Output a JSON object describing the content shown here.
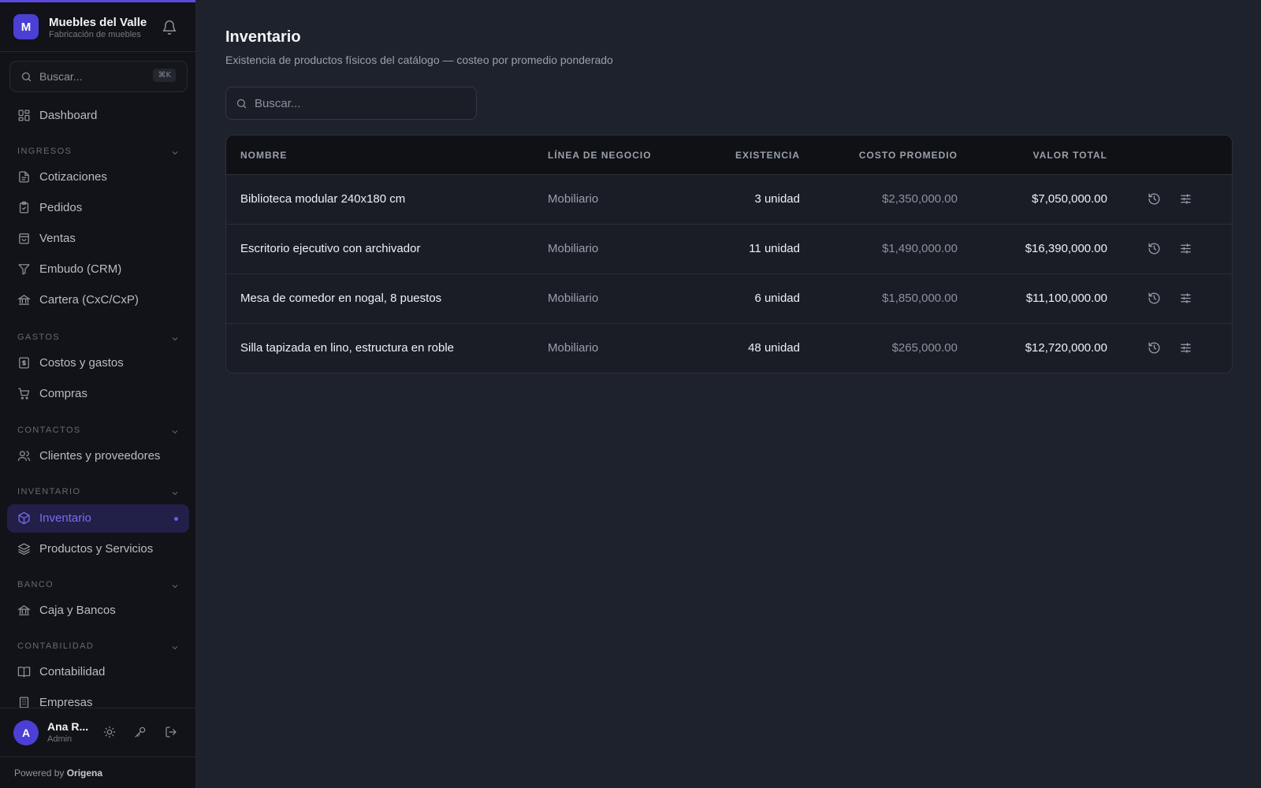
{
  "brand": {
    "initial": "M",
    "name": "Muebles del Valle",
    "subtitle": "Fabricación de muebles"
  },
  "sidebar": {
    "search_placeholder": "Buscar...",
    "search_shortcut": "⌘K",
    "dashboard": "Dashboard",
    "sections": {
      "ingresos": "INGRESOS",
      "gastos": "GASTOS",
      "contactos": "CONTACTOS",
      "inventario": "INVENTARIO",
      "banco": "BANCO",
      "contabilidad": "CONTABILIDAD"
    },
    "items": {
      "cotizaciones": "Cotizaciones",
      "pedidos": "Pedidos",
      "ventas": "Ventas",
      "embudo": "Embudo (CRM)",
      "cartera": "Cartera (CxC/CxP)",
      "costos": "Costos y gastos",
      "compras": "Compras",
      "clientes": "Clientes y proveedores",
      "inventario": "Inventario",
      "productos": "Productos y Servicios",
      "caja": "Caja y Bancos",
      "contabilidad": "Contabilidad",
      "empresas": "Empresas"
    }
  },
  "user": {
    "initial": "A",
    "name": "Ana R...",
    "role": "Admin"
  },
  "footer": {
    "powered_prefix": "Powered by",
    "powered_brand": "Origena"
  },
  "page": {
    "title": "Inventario",
    "subtitle": "Existencia de productos físicos del catálogo — costeo por promedio ponderado",
    "search_placeholder": "Buscar..."
  },
  "table": {
    "headers": {
      "name": "NOMBRE",
      "line": "LÍNEA DE NEGOCIO",
      "qty": "EXISTENCIA",
      "cost": "COSTO PROMEDIO",
      "total": "VALOR TOTAL"
    },
    "rows": [
      {
        "name": "Biblioteca modular 240x180 cm",
        "line": "Mobiliario",
        "qty": "3 unidad",
        "cost": "$2,350,000.00",
        "total": "$7,050,000.00"
      },
      {
        "name": "Escritorio ejecutivo con archivador",
        "line": "Mobiliario",
        "qty": "11 unidad",
        "cost": "$1,490,000.00",
        "total": "$16,390,000.00"
      },
      {
        "name": "Mesa de comedor en nogal, 8 puestos",
        "line": "Mobiliario",
        "qty": "6 unidad",
        "cost": "$1,850,000.00",
        "total": "$11,100,000.00"
      },
      {
        "name": "Silla tapizada en lino, estructura en roble",
        "line": "Mobiliario",
        "qty": "48 unidad",
        "cost": "$265,000.00",
        "total": "$12,720,000.00"
      }
    ]
  },
  "colors": {
    "accent": "#5b4be0",
    "active_nav_bg": "#221f48",
    "active_nav_text": "#7b6df2",
    "sidebar_bg": "#111318",
    "main_bg": "#1e222c"
  },
  "icons": {
    "row_actions": [
      "history-icon",
      "adjust-icon"
    ]
  }
}
